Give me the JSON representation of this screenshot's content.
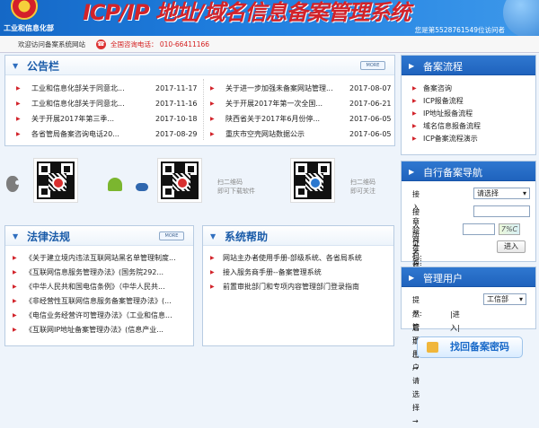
{
  "header": {
    "ministry": "工业和信息化部",
    "title": "ICP/IP 地址/域名信息备案管理系统",
    "visit_text": "您是第5528761549位访问者"
  },
  "info_bar": {
    "welcome": "欢迎访问备案系统网站",
    "phone": "全国咨询电话： 010-66411166"
  },
  "announcement": {
    "title": "公告栏",
    "more": "MORE",
    "items": [
      {
        "title": "工业和信息化部关于同意北...",
        "date": "2017-11-17"
      },
      {
        "title": "工业和信息化部关于同意北...",
        "date": "2017-11-16"
      },
      {
        "title": "关于开展2017年第三季...",
        "date": "2017-10-18"
      },
      {
        "title": "各省管局备案咨询电话20...",
        "date": "2017-08-29"
      },
      {
        "title": "关于进一步加强未备案网站管理...",
        "date": "2017-08-07"
      },
      {
        "title": "关于开展2017年第一次全国...",
        "date": "2017-06-21"
      },
      {
        "title": "陕西省关于2017年6月份停...",
        "date": "2017-06-05"
      },
      {
        "title": "重庆市空壳网站数据公示",
        "date": "2017-06-05"
      }
    ]
  },
  "downloads": {
    "android_text": "扫二维码\n即可下载软件",
    "follow_text": "扫二维码\n即可关注"
  },
  "laws": {
    "title": "法律法规",
    "more": "MORE",
    "items": [
      "《关于建立境内违法互联网站黑名单管理制度...",
      "《互联网信息服务管理办法》(国务院292...",
      "《中华人民共和国电信条例》（中华人民共...",
      "《非经营性互联网信息服务备案管理办法》(...",
      "《电信业务经营许可管理办法》（工业和信息...",
      "《互联网IP地址备案管理办法》(信息产业..."
    ]
  },
  "help": {
    "title": "系统帮助",
    "items": [
      "网站主办者使用手册-部级系统、各省局系统",
      "接入服务商手册--备案管理系统",
      "前置审批部门和专项内容管理部门登录指南"
    ]
  },
  "flow": {
    "title": "备案流程",
    "items": [
      "备案咨询",
      "ICP报备流程",
      "IP地址报备流程",
      "域名信息报备流程",
      "ICP备案流程演示"
    ]
  },
  "self": {
    "title": "自行备案导航",
    "access_label": "接入商所在省:",
    "access_value": "请选择",
    "name_label": "接入商名称:",
    "code_label": "验证码:",
    "captcha": "7%C",
    "enter": "进入"
  },
  "admin": {
    "title": "管理用户",
    "prompt": "提示:管理用户请选择→",
    "select": "工信部",
    "then": "然后点击→",
    "enter": "|进入|"
  },
  "password": {
    "text": "找回备案密码"
  }
}
